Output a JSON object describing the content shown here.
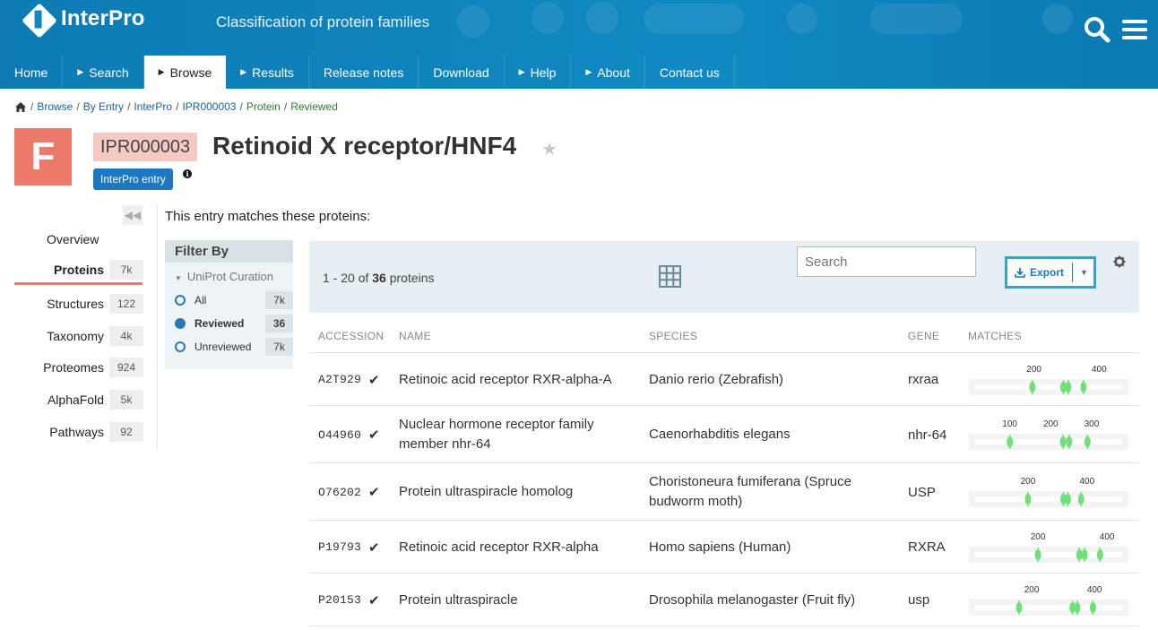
{
  "header": {
    "logo_text": "InterPro",
    "tagline": "Classification of protein families",
    "icons": [
      "search-icon",
      "menu-icon"
    ],
    "nav": [
      {
        "label": "Home",
        "caret": false,
        "active": false
      },
      {
        "label": "Search",
        "caret": true,
        "active": false
      },
      {
        "label": "Browse",
        "caret": true,
        "active": true
      },
      {
        "label": "Results",
        "caret": true,
        "active": false
      },
      {
        "label": "Release notes",
        "caret": false,
        "active": false
      },
      {
        "label": "Download",
        "caret": false,
        "active": false
      },
      {
        "label": "Help",
        "caret": true,
        "active": false
      },
      {
        "label": "About",
        "caret": true,
        "active": false
      },
      {
        "label": "Contact us",
        "caret": false,
        "active": false
      }
    ]
  },
  "breadcrumb": [
    "Browse",
    "By Entry",
    "InterPro",
    "IPR000003",
    "Protein",
    "Reviewed"
  ],
  "entry": {
    "type_letter": "F",
    "accession": "IPR000003",
    "name": "Retinoid X receptor/HNF4",
    "type_tag": "InterPro entry",
    "info": "i",
    "accent_color": "#ec7a6b"
  },
  "menu": {
    "overview": "Overview",
    "items": [
      {
        "label": "Proteins",
        "count": "7k",
        "active": true
      },
      {
        "label": "Structures",
        "count": "122",
        "active": false
      },
      {
        "label": "Taxonomy",
        "count": "4k",
        "active": false
      },
      {
        "label": "Proteomes",
        "count": "924",
        "active": false
      },
      {
        "label": "AlphaFold",
        "count": "5k",
        "active": false
      },
      {
        "label": "Pathways",
        "count": "92",
        "active": false
      }
    ]
  },
  "intro": "This entry matches these proteins:",
  "filter": {
    "title": "Filter By",
    "section": "UniProt Curation",
    "options": [
      {
        "label": "All",
        "count": "7k",
        "selected": false
      },
      {
        "label": "Reviewed",
        "count": "36",
        "selected": true
      },
      {
        "label": "Unreviewed",
        "count": "7k",
        "selected": false
      }
    ]
  },
  "table": {
    "pager_range": "1 - 20 of",
    "pager_total": "36",
    "pager_unit": "proteins",
    "search_placeholder": "Search",
    "export_label": "Export",
    "columns": [
      "ACCESSION",
      "NAME",
      "SPECIES",
      "GENE",
      "MATCHES"
    ],
    "rows": [
      {
        "accession": "A2T929",
        "name": "Retinoic acid receptor RXR-alpha-A",
        "species": "Danio rerio (Zebrafish)",
        "gene": "rxraa",
        "ticks": [
          {
            "label": "200",
            "pos": 200
          },
          {
            "label": "400",
            "pos": 400
          }
        ],
        "length": 490,
        "domains": [
          195,
          290,
          305,
          352
        ]
      },
      {
        "accession": "O44960",
        "name": "Nuclear hormone receptor family member nhr-64",
        "species": "Caenorhabditis elegans",
        "gene": "nhr-64",
        "ticks": [
          {
            "label": "100",
            "pos": 100
          },
          {
            "label": "200",
            "pos": 200
          },
          {
            "label": "300",
            "pos": 300
          }
        ],
        "length": 390,
        "domains": [
          100,
          230,
          245,
          290
        ]
      },
      {
        "accession": "O76202",
        "name": "Protein ultraspiracle homolog",
        "species": "Choristoneura fumiferana (Spruce budworm moth)",
        "gene": "USP",
        "ticks": [
          {
            "label": "200",
            "pos": 200
          },
          {
            "label": "400",
            "pos": 400
          }
        ],
        "length": 540,
        "domains": [
          200,
          320,
          335,
          380
        ]
      },
      {
        "accession": "P19793",
        "name": "Retinoic acid receptor RXR-alpha",
        "species": "Homo sapiens (Human)",
        "gene": "RXRA",
        "ticks": [
          {
            "label": "200",
            "pos": 200
          },
          {
            "label": "400",
            "pos": 400
          }
        ],
        "length": 462,
        "domains": [
          200,
          320,
          335,
          380
        ]
      },
      {
        "accession": "P20153",
        "name": "Protein ultraspiracle",
        "species": "Drosophila melanogaster (Fruit fly)",
        "gene": "usp",
        "ticks": [
          {
            "label": "200",
            "pos": 200
          },
          {
            "label": "400",
            "pos": 400
          }
        ],
        "length": 508,
        "domains": [
          160,
          330,
          345,
          395
        ]
      }
    ]
  },
  "colors": {
    "header_blue": "#1089c2",
    "link_blue": "#1a63a8",
    "match_green": "#6fe07a",
    "export_border": "#3aa1c9"
  }
}
